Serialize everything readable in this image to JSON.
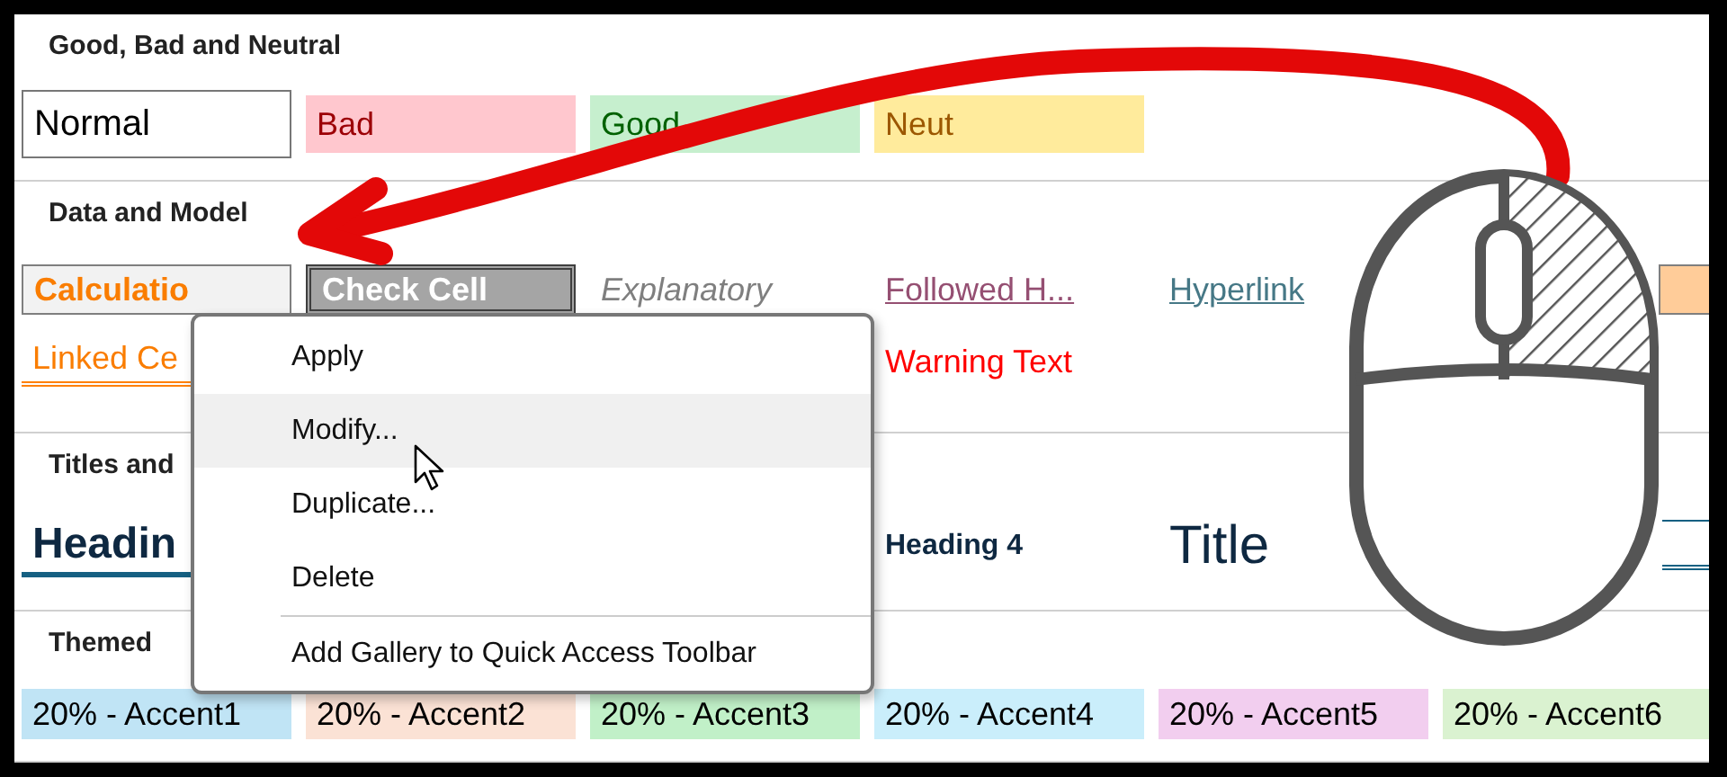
{
  "sections": [
    {
      "title": "Good, Bad and Neutral",
      "rows": [
        [
          {
            "kind": "normal",
            "label": "Normal"
          },
          {
            "kind": "bad",
            "label": "Bad"
          },
          {
            "kind": "good",
            "label": "Good"
          },
          {
            "kind": "neutral",
            "label": "Neut"
          }
        ]
      ]
    },
    {
      "title": "Data and Model",
      "rows": [
        [
          {
            "kind": "calculation",
            "label": "Calculatio"
          },
          {
            "kind": "check",
            "label": "Check Cell"
          },
          {
            "kind": "explanatory",
            "label": "Explanatory"
          },
          {
            "kind": "followed",
            "label": "Followed H..."
          },
          {
            "kind": "hyperlink",
            "label": "Hyperlink"
          },
          {
            "kind": "input"
          }
        ],
        [
          {
            "kind": "linked",
            "label": "Linked Ce"
          },
          null,
          null,
          {
            "kind": "warning",
            "label": "Warning Text"
          }
        ]
      ]
    },
    {
      "title": "Titles and",
      "rows": [
        [
          {
            "kind": "heading1",
            "label": "Headin"
          },
          null,
          null,
          {
            "kind": "heading4",
            "label": "Heading 4"
          },
          {
            "kind": "title",
            "label": "Title"
          },
          {
            "kind": "total"
          }
        ]
      ]
    },
    {
      "title": "Themed",
      "rows": [
        [
          {
            "kind": "accent1",
            "label": "20% - Accent1"
          },
          {
            "kind": "accent2",
            "label": "20% - Accent2"
          },
          {
            "kind": "accent3",
            "label": "20% - Accent3"
          },
          {
            "kind": "accent4",
            "label": "20% - Accent4"
          },
          {
            "kind": "accent5",
            "label": "20% - Accent5"
          },
          {
            "kind": "accent6",
            "label": "20% - Accent6"
          }
        ]
      ]
    }
  ],
  "menu": {
    "items": [
      {
        "label": "Apply",
        "selected": false
      },
      {
        "label": "Modify...",
        "selected": true
      },
      {
        "label": "Duplicate...",
        "selected": false
      },
      {
        "label": "Delete",
        "selected": false,
        "separator_after": true
      },
      {
        "label": "Add Gallery to Quick Access Toolbar",
        "selected": false
      }
    ]
  }
}
